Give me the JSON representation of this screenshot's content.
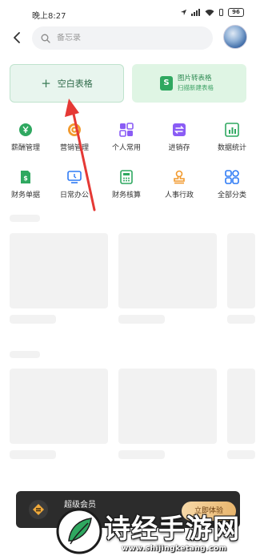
{
  "status_bar": {
    "time": "晚上8:27",
    "battery": "96"
  },
  "search": {
    "placeholder": "备忘录"
  },
  "actions": {
    "blank_sheet": {
      "plus": "+",
      "label": "空白表格"
    },
    "photo_to_sheet": {
      "icon_letter": "S",
      "title": "图片转表格",
      "subtitle": "扫描新建表格"
    }
  },
  "categories": [
    {
      "label": "薪酬管理",
      "icon": "yen-coin-icon",
      "color": "#2fa860"
    },
    {
      "label": "营销管理",
      "icon": "target-icon",
      "color": "#f29a2e"
    },
    {
      "label": "个人常用",
      "icon": "grid-apps-icon",
      "color": "#8a5cf5"
    },
    {
      "label": "进销存",
      "icon": "swap-arrows-icon",
      "color": "#8a5cf5"
    },
    {
      "label": "数据统计",
      "icon": "bar-chart-icon",
      "color": "#2fa860"
    },
    {
      "label": "财务单据",
      "icon": "dollar-doc-icon",
      "color": "#2fa860"
    },
    {
      "label": "日常办公",
      "icon": "monitor-icon",
      "color": "#2f7bf5"
    },
    {
      "label": "财务核算",
      "icon": "calculator-icon",
      "color": "#2fa860"
    },
    {
      "label": "人事行政",
      "icon": "stamp-icon",
      "color": "#f29a2e"
    },
    {
      "label": "全部分类",
      "icon": "four-grid-icon",
      "color": "#2f7bf5"
    }
  ],
  "vip": {
    "title": "超级会员",
    "button": "立即体验"
  },
  "watermark": {
    "title": "诗经手游网",
    "url": "www.shijingketang.com"
  },
  "colors": {
    "accent_green": "#2fa860",
    "arrow_red": "#e53935",
    "skeleton": "#f2f2f2"
  }
}
